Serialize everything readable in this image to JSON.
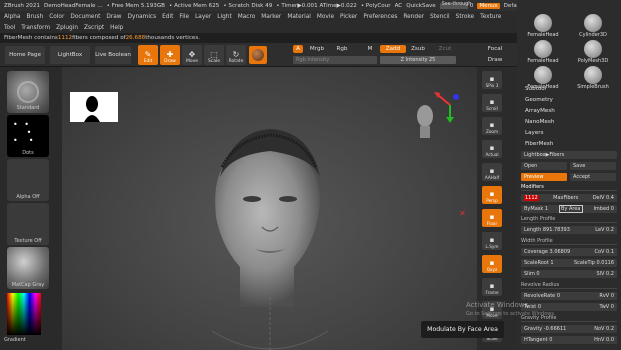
{
  "titlebar": {
    "app": "ZBrush 2021",
    "file": "DemoHeadFemale ...",
    "free_mem": "• Free Mem 5.193GB",
    "active_mem": "• Active Mem 625",
    "scratch": "• Scratch Disk 49",
    "timer": "• Timer▶0.001 ATime▶0.022",
    "polycount": "• PolyCour",
    "ac": "AC",
    "quicksave": "QuickSave",
    "see_through": "See-through",
    "see_through_value": "0",
    "see_through_level": 0,
    "menus": "Menus",
    "script": "DefaultZScript"
  },
  "menubar": {
    "row1": [
      "Alpha",
      "Brush",
      "Color",
      "Document",
      "Draw",
      "Dynamics",
      "Edit",
      "File",
      "Layer",
      "Light",
      "Macro",
      "Marker",
      "Material",
      "Movie",
      "Picker",
      "Preferences",
      "Render",
      "Stencil",
      "Stroke",
      "Texture"
    ],
    "row2": [
      "Tool",
      "Transform",
      "Zplugin",
      "Zscript",
      "Help"
    ]
  },
  "info": {
    "prefix": "FiberMesh contains ",
    "count": "1112",
    "middle": " fibers composed of ",
    "thousands": "26.688",
    "suffix": " thousands vertices."
  },
  "topshelf": {
    "home_page": "Home Page",
    "lightbox": "LightBox",
    "live_boolean": "Live Boolean",
    "edit": "Edit",
    "draw": "Draw",
    "move": "Move",
    "scale": "Scale",
    "rotate": "Rotate",
    "a": "A",
    "mrgb": "Mrgb",
    "rgb": "Rgb",
    "m": "M",
    "rgb_intensity": "Rgb Intensity",
    "zadd": "Zadd",
    "zsub": "Zsub",
    "zcut": "Zcut",
    "z_intensity": "Z Intensity 25",
    "focal": "Focal",
    "draw_size": "Draw"
  },
  "leftshelf": {
    "standard": "Standard",
    "dots": "Dots",
    "alpha_off": "Alpha Off",
    "texture_off": "Texture Off",
    "matcap": "MatCap Gray",
    "gradient": "Gradient"
  },
  "rightshelf": {
    "spix": "SPix 3",
    "scroll": "Scroll",
    "zoom": "Zoom",
    "actual": "Actual",
    "aahalf": "AAHalf",
    "persp": "Persp",
    "floor": "Floor",
    "lsym": "L.Sym",
    "xyz": "Qxyz",
    "frame": "Frame",
    "move": "Move",
    "scale": "Scale"
  },
  "tray": {
    "tools": [
      "FemaleHead",
      "Cylinder3D",
      "FemaleHead",
      "PolyMesh3D",
      "FemaleHead",
      "SimpleBrush"
    ],
    "tool_count": "2",
    "menu": [
      "Subtool",
      "Geometry",
      "ArrayMesh",
      "NanoMesh",
      "Layers",
      "FiberMesh"
    ],
    "lightbox_fibers": "Lightbox▶Fibers",
    "open": "Open",
    "save": "Save",
    "preview": "Preview",
    "accept": "Accept",
    "modifiers": "Modifiers",
    "maxfibers_label": "MaxFibers",
    "maxfibers_value": "1112",
    "delv": "DelV 0.4",
    "bymask": "ByMask 1",
    "byarea": "By Area",
    "imbed": "Imbed 0",
    "length_profile": "Length Profile",
    "length": "Length 891.78393",
    "lev": "LeV 0.2",
    "width_profile": "Width Profile",
    "coverage": "Coverage 3.06809",
    "cov": "CoV 0.1",
    "scaleroot": "ScaleRoot 1",
    "scaletip": "ScaleTip 0.0116",
    "slim": "Slim 0",
    "slv": "SlV 0.2",
    "revolve_radius": "Revolve Radius",
    "revolverate": "RevolveRate 0",
    "rvv": "RvV 0",
    "twist": "Twist 0",
    "twv": "TwV 0",
    "gravity_profile": "Gravity Profile",
    "gravity": "Gravity -0.66611",
    "grv": "NoV 0.2",
    "htangent": "HTangent 0",
    "hnv": "HnV 0.0"
  },
  "tooltip": "Modulate By Face Area",
  "watermark": "Activate Windows",
  "watermark_sub": "Go to Settings to activate Windows.",
  "colors": {
    "accent": "#e8760a",
    "bg": "#262626"
  }
}
